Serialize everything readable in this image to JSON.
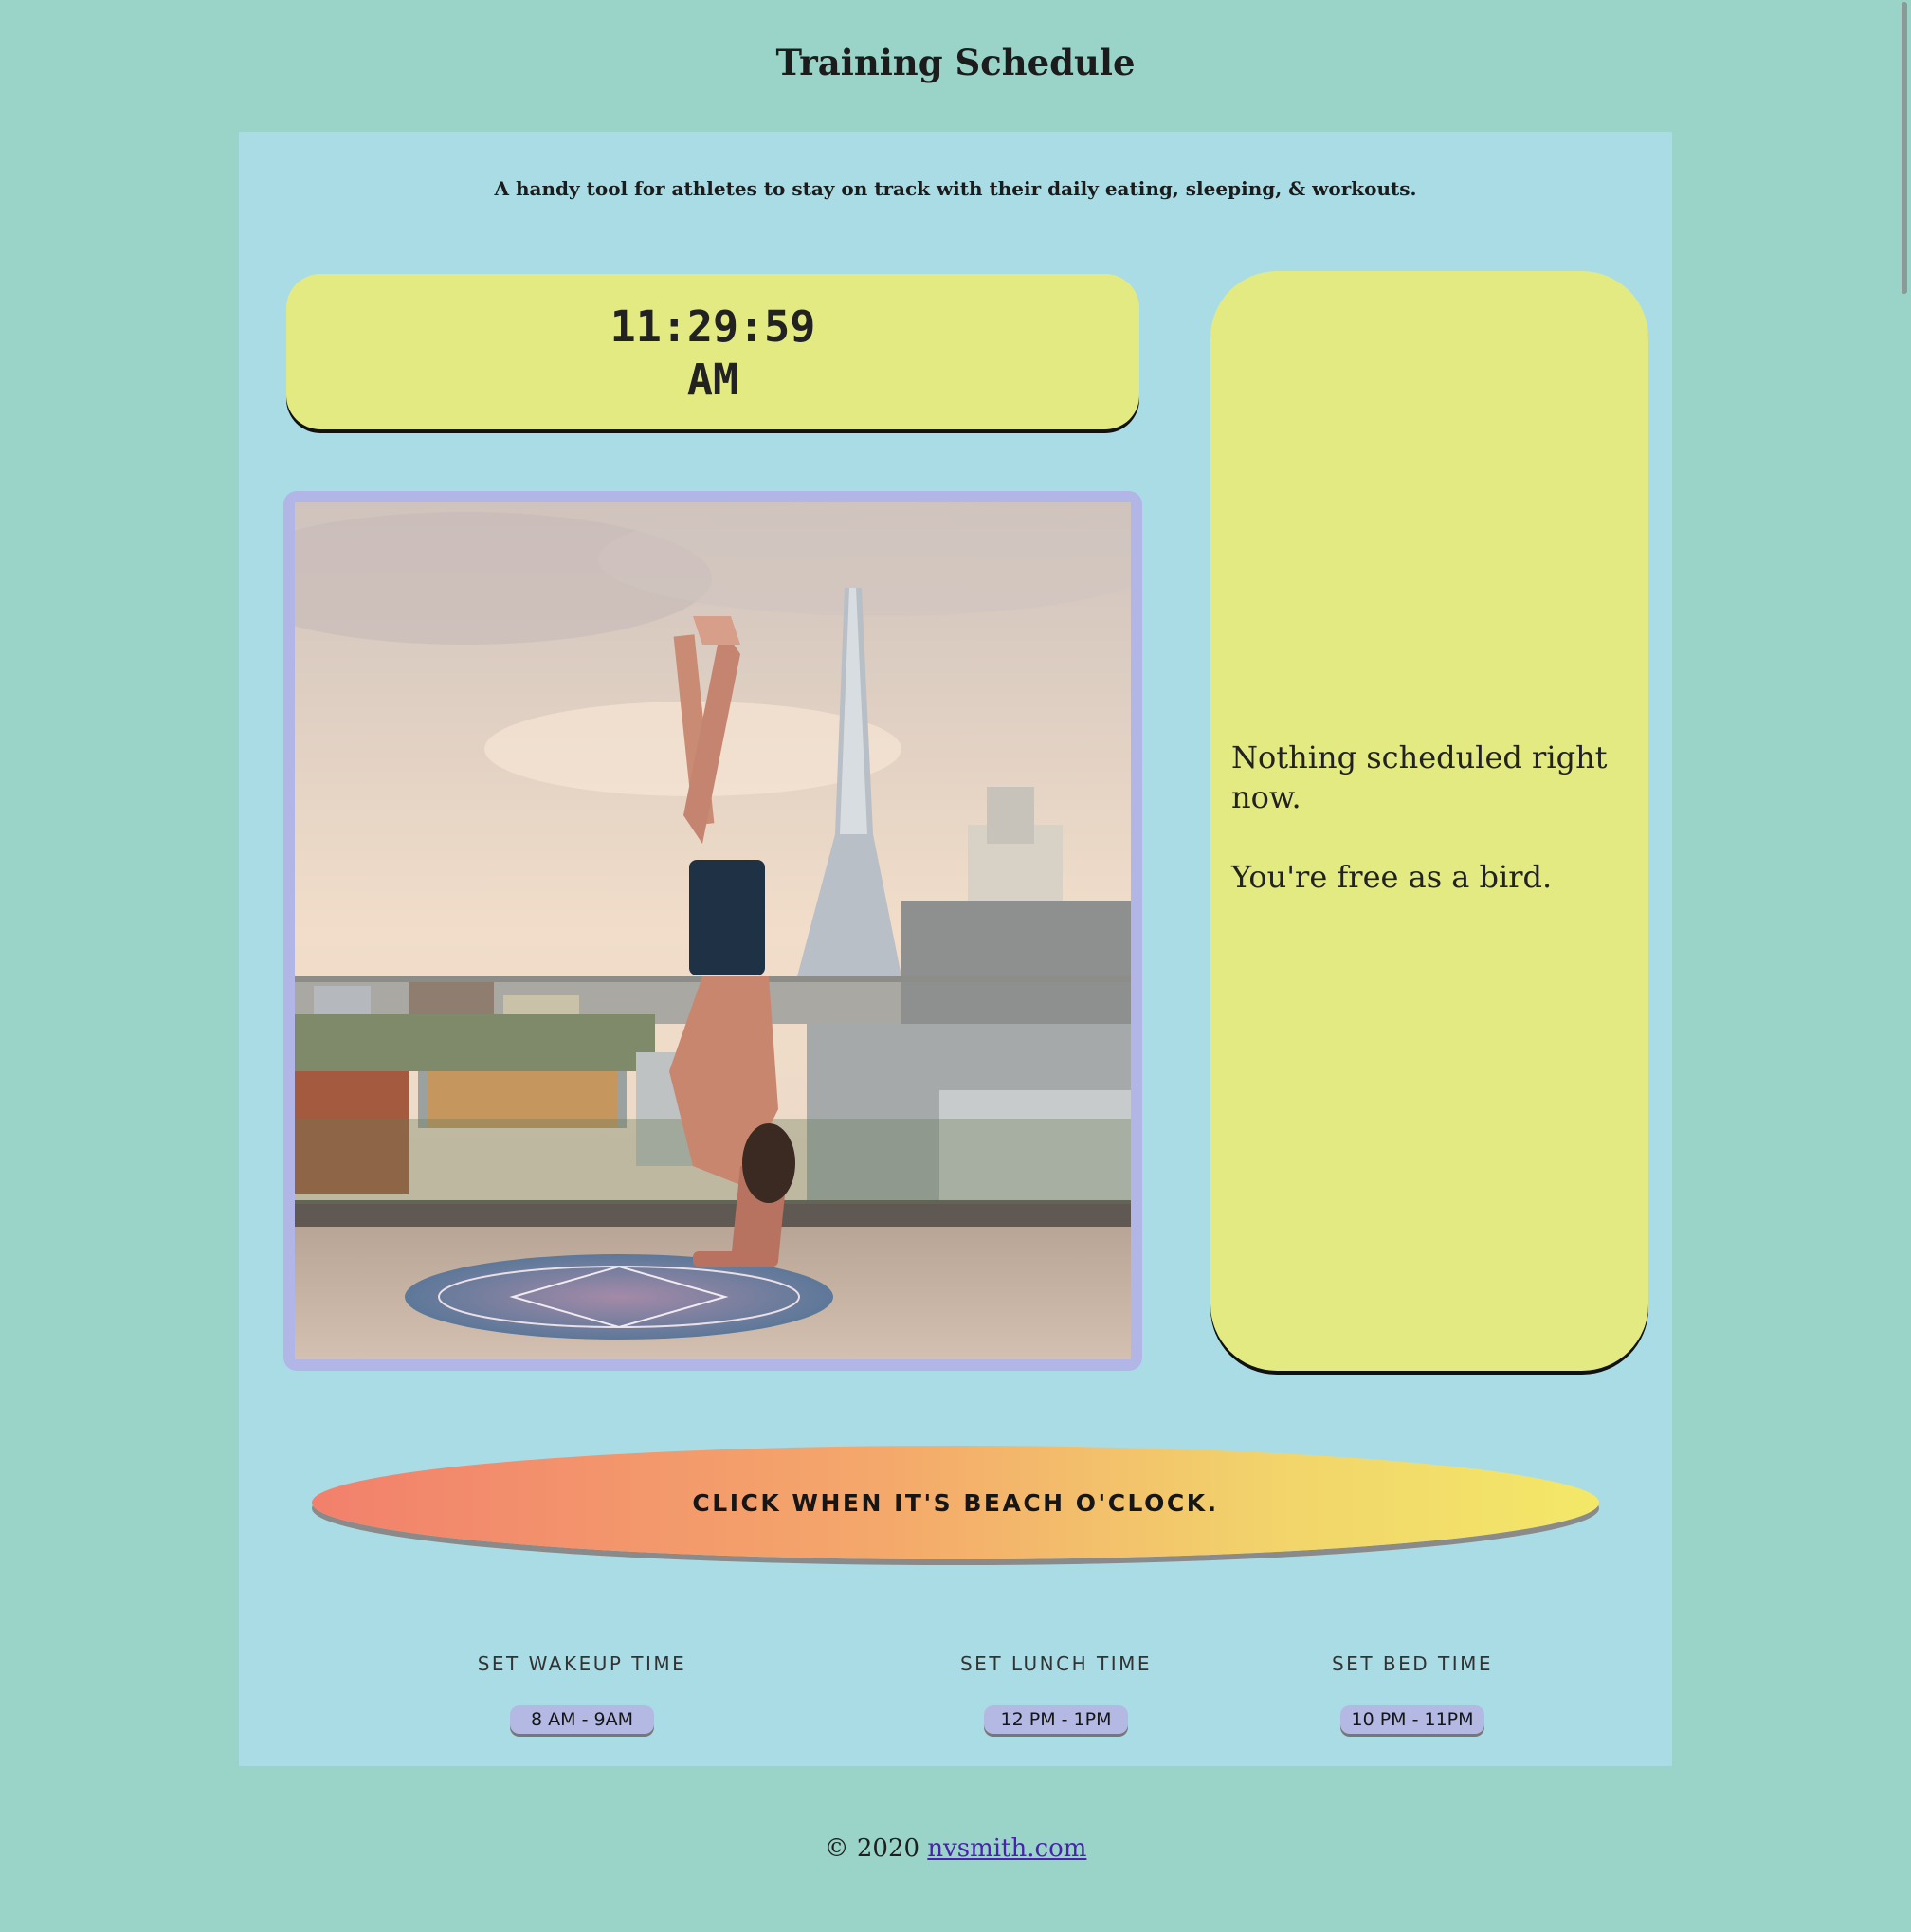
{
  "page": {
    "title": "Training Schedule",
    "subtitle": "A handy tool for athletes to stay on track with their daily eating, sleeping, & workouts."
  },
  "clock": {
    "time": "11:29:59",
    "period": "AM"
  },
  "photo": {
    "alt": "Man doing a handstand on a rooftop yoga mat with a city skyline behind"
  },
  "schedule": {
    "line1": "Nothing scheduled right now.",
    "line2": "You're free as a bird."
  },
  "beach_button": {
    "label": "CLICK WHEN IT'S BEACH O'CLOCK."
  },
  "settings": {
    "wakeup": {
      "label": "SET WAKEUP TIME",
      "value": "8 AM - 9AM"
    },
    "lunch": {
      "label": "SET LUNCH TIME",
      "value": "12 PM - 1PM"
    },
    "bed": {
      "label": "SET BED TIME",
      "value": "10 PM - 11PM"
    }
  },
  "footer": {
    "copyright": "© 2020",
    "link_text": "nvsmith.com"
  },
  "colors": {
    "page_bg": "#9ad4c9",
    "card_bg": "#aadce5",
    "panel_yellow": "#e2ea81",
    "frame_lavender": "#b2b6e6",
    "link": "#4b22b0"
  }
}
